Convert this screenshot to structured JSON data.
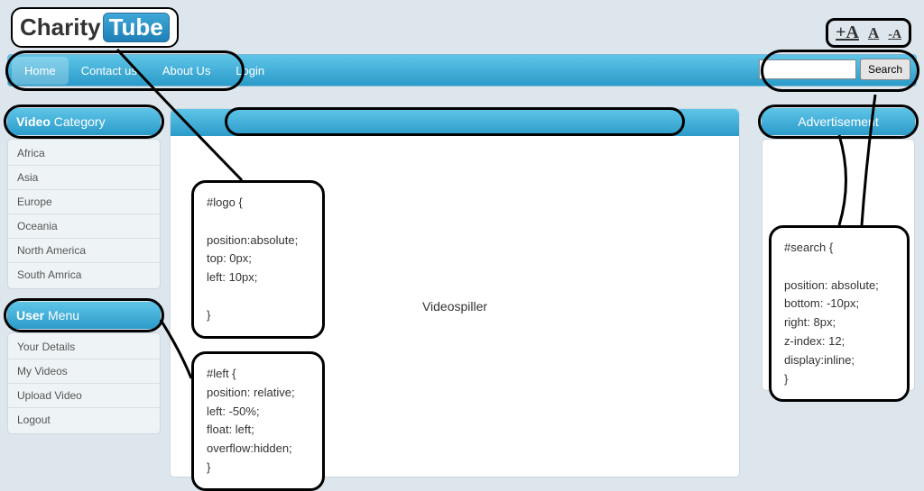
{
  "logo": {
    "part1": "Charity",
    "part2": "Tube"
  },
  "font_controls": {
    "big": "+A",
    "mid": "A",
    "small": "-A"
  },
  "nav": {
    "items": [
      {
        "label": "Home",
        "active": true
      },
      {
        "label": "Contact us",
        "active": false
      },
      {
        "label": "About Us",
        "active": false
      },
      {
        "label": "Login",
        "active": false
      }
    ]
  },
  "search": {
    "placeholder": "",
    "button": "Search"
  },
  "video_category": {
    "title_bold": "Video",
    "title_rest": " Category",
    "items": [
      "Africa",
      "Asia",
      "Europe",
      "Oceania",
      "North America",
      "South Amrica"
    ]
  },
  "user_menu": {
    "title_bold": "User",
    "title_rest": " Menu",
    "items": [
      "Your Details",
      "My Videos",
      "Upload Video",
      "Logout"
    ]
  },
  "main": {
    "content": "Videospiller"
  },
  "advertisement": {
    "title": "Advertisement"
  },
  "callouts": {
    "logo": "#logo {\n\nposition:absolute;\ntop: 0px;\nleft: 10px;\n\n}",
    "left": "#left {\nposition: relative;\nleft: -50%;\nfloat: left;\noverflow:hidden;\n}",
    "search": "#search {\n\nposition: absolute;\nbottom: -10px;\nright: 8px;\nz-index: 12;\ndisplay:inline;\n}"
  }
}
